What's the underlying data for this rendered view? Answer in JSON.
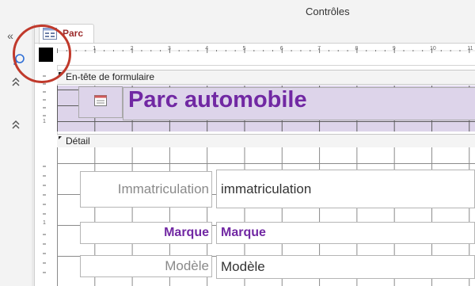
{
  "window": {
    "title": "Contrôles"
  },
  "nav": {
    "collapse_icon": "double-chevron-left",
    "search_icon": "search",
    "expand_up_icon": "double-chevron-up"
  },
  "document_tab": {
    "label": "Parc",
    "icon": "form-icon"
  },
  "ruler": {
    "horizontal_marks": [
      "1",
      "2",
      "3",
      "4",
      "5",
      "6",
      "7",
      "8",
      "9",
      "10",
      "11"
    ],
    "vertical_marks": [
      "1",
      "1",
      "1"
    ]
  },
  "sections": {
    "header_label": "En-tête de formulaire",
    "detail_label": "Détail"
  },
  "form_header": {
    "title": "Parc automobile"
  },
  "detail": {
    "immatriculation": {
      "label": "Immatriculation",
      "field": "immatriculation"
    },
    "marque": {
      "label": "Marque",
      "field": "Marque"
    },
    "modele": {
      "label": "Modèle",
      "field": "Modèle"
    }
  },
  "colors": {
    "header_band": "#ddd4ea",
    "title_purple": "#7128a3",
    "tab_label": "#9c2b2b",
    "highlight_circle": "#c0392b"
  }
}
